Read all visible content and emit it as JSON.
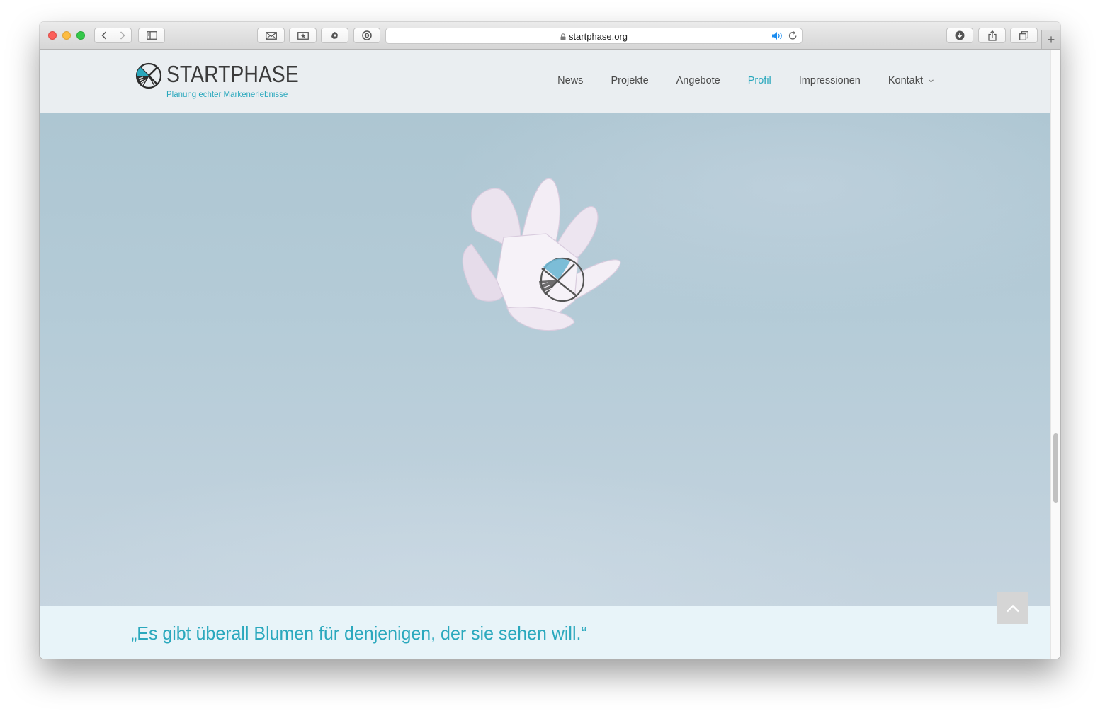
{
  "browser": {
    "url": "startphase.org",
    "new_tab": "+"
  },
  "site": {
    "logo_name": "STARTPHASE",
    "logo_tagline": "Planung echter Markenerlebnisse",
    "nav": [
      {
        "label": "News"
      },
      {
        "label": "Projekte"
      },
      {
        "label": "Angebote"
      },
      {
        "label": "Profil",
        "active": true
      },
      {
        "label": "Impressionen"
      },
      {
        "label": "Kontakt"
      }
    ],
    "quote": "„Es gibt überall Blumen für denjenigen, der sie sehen will.“"
  },
  "colors": {
    "accent": "#2aa8bd",
    "header_bg": "#eaeef1",
    "quote_bg": "#e8f4f9",
    "hero_bg": "#b4cbd7"
  },
  "icons": {
    "toolbar": [
      "back-icon",
      "forward-icon",
      "sidebar-icon",
      "mail-icon",
      "bookmark-icon",
      "extension-icon",
      "password-icon",
      "lock-icon",
      "speaker-icon",
      "reload-icon",
      "download-icon",
      "share-icon",
      "tabs-icon"
    ],
    "page": [
      "logo-mark-icon",
      "chevron-down-icon",
      "chevron-up-icon"
    ]
  }
}
